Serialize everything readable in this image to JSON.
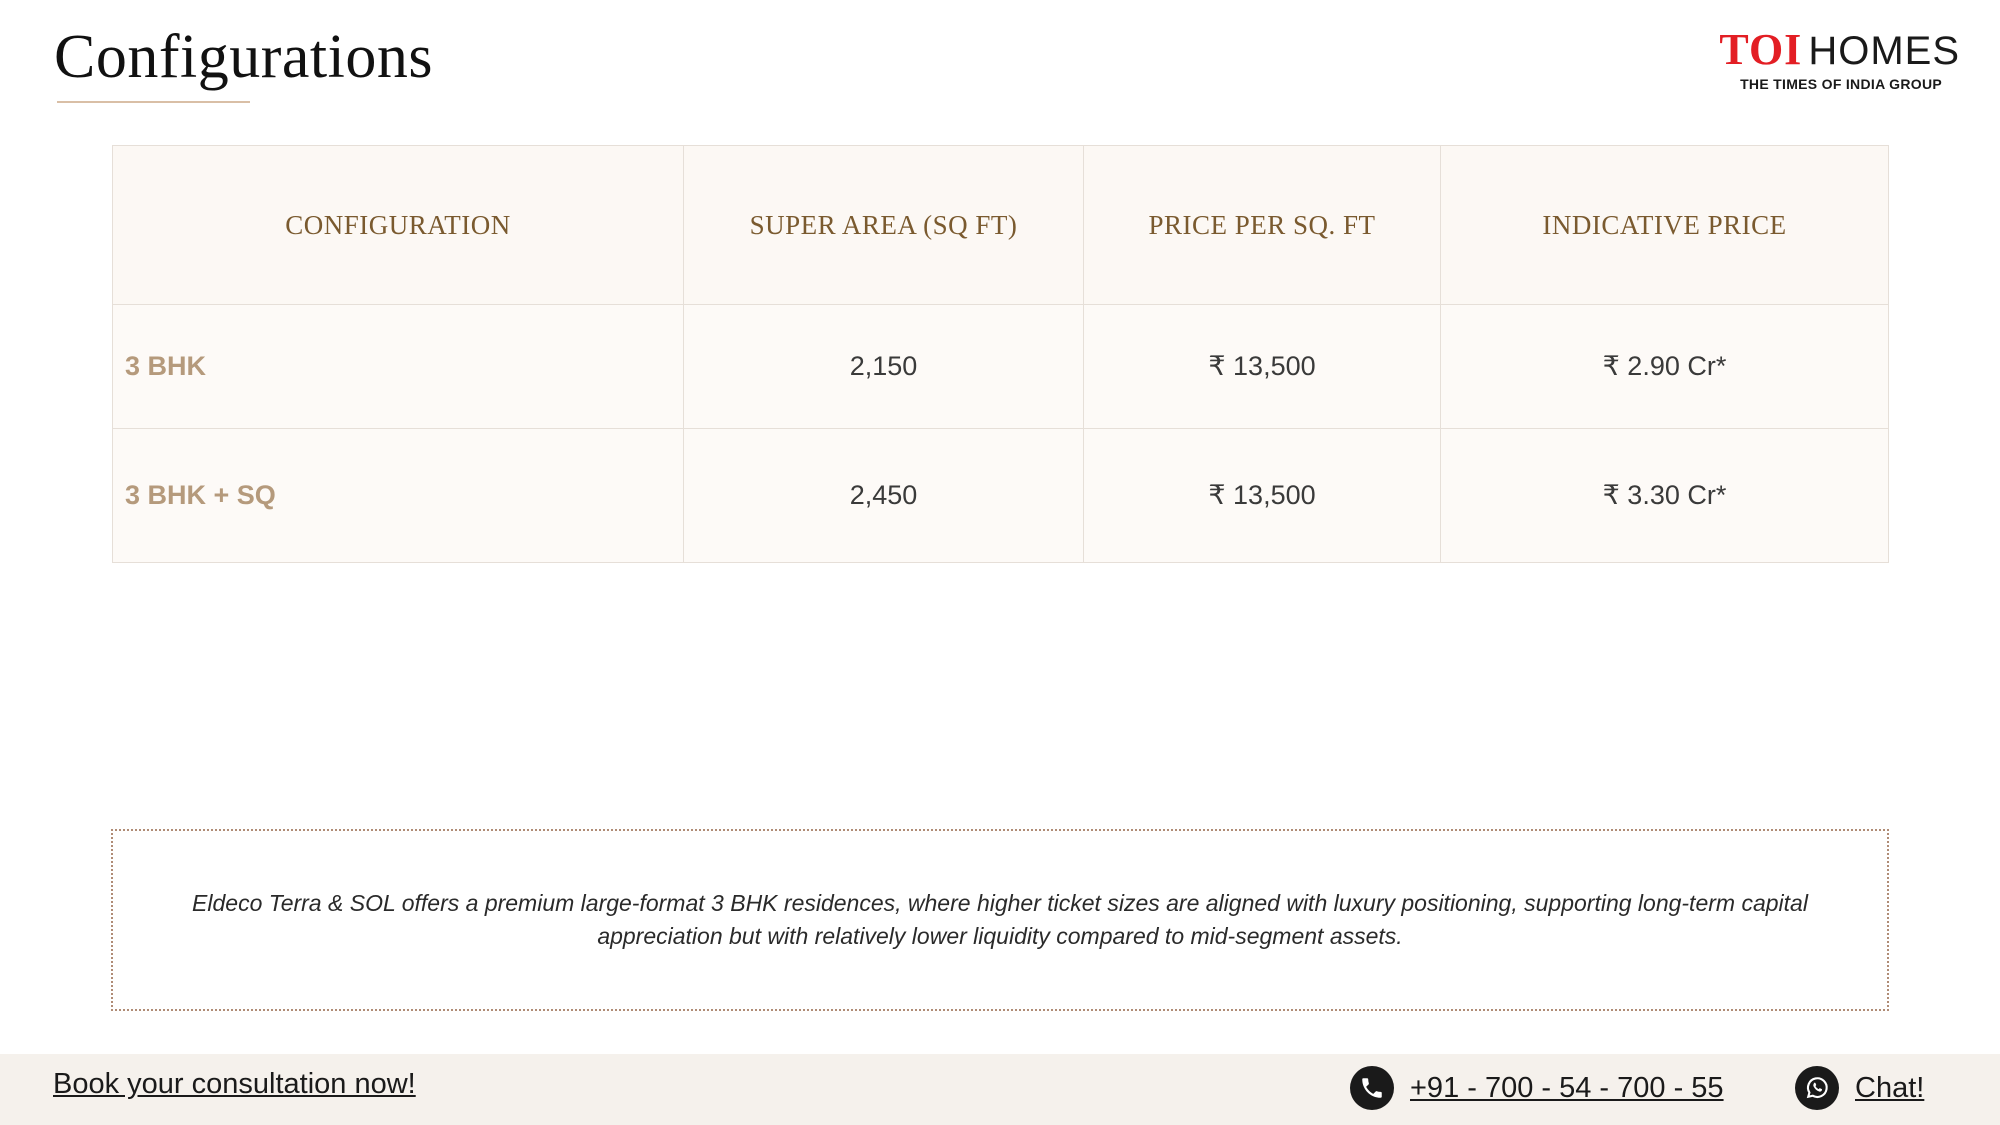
{
  "header": {
    "title": "Configurations",
    "logo": {
      "primary": "TOI",
      "secondary": "HOMES",
      "tagline": "THE TIMES OF INDIA GROUP"
    }
  },
  "table": {
    "headers": [
      "CONFIGURATION",
      "SUPER AREA (SQ FT)",
      "PRICE PER SQ. FT",
      "INDICATIVE PRICE"
    ],
    "rows": [
      {
        "configuration": "3 BHK",
        "super_area": "2,150",
        "price_per_sqft": "₹ 13,500",
        "indicative_price": "₹ 2.90 Cr*"
      },
      {
        "configuration": "3 BHK + SQ",
        "super_area": "2,450",
        "price_per_sqft": "₹ 13,500",
        "indicative_price": "₹ 3.30 Cr*"
      }
    ]
  },
  "note": {
    "text": "Eldeco Terra & SOL offers a premium large-format 3 BHK residences, where higher ticket sizes are aligned with luxury positioning, supporting long-term capital appreciation but with relatively lower liquidity compared to mid-segment assets."
  },
  "footer": {
    "cta_label": "Book your consultation now!",
    "phone_label": "+91 - 700 - 54 - 700 - 55",
    "chat_label": "Chat!"
  },
  "colors": {
    "title_underline": "#d9bfa6",
    "header_text": "#7a5a2f",
    "config_text": "#b59a7c",
    "logo_red": "#e31e24",
    "footer_bg": "#f5f1ec"
  },
  "icons": {
    "phone": "phone-icon",
    "chat": "whatsapp-icon"
  }
}
